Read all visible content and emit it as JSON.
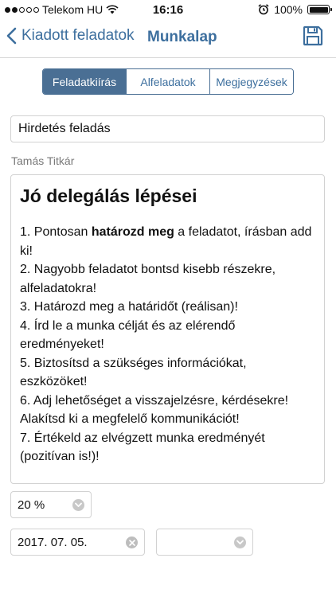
{
  "status_bar": {
    "carrier": "Telekom HU",
    "time": "16:16",
    "battery": "100%",
    "signal_dots_filled": 2,
    "signal_dots_total": 5
  },
  "nav": {
    "back_label": "Kiadott feladatok",
    "title": "Munkalap"
  },
  "tabs": [
    {
      "label": "Feladatkiírás",
      "active": true
    },
    {
      "label": "Alfeladatok",
      "active": false
    },
    {
      "label": "Megjegyzések",
      "active": false
    }
  ],
  "task": {
    "title_value": "Hirdetés feladás",
    "assignee": "Tamás Titkár",
    "description": {
      "heading": "Jó delegálás lépései",
      "steps": [
        {
          "prefix": "1. Pontosan ",
          "bold": "határozd meg",
          "suffix": " a feladatot, írásban add ki!"
        },
        {
          "text": "2. Nagyobb feladatot bontsd kisebb részekre, alfeladatokra!"
        },
        {
          "text": "3. Határozd meg a határidőt (reálisan)!"
        },
        {
          "text": "4. Írd le a munka célját és az elérendő eredményeket!"
        },
        {
          "text": "5. Biztosítsd a szükséges információkat, eszközöket!"
        },
        {
          "text": "6. Adj lehetőséget a visszajelzésre, kérdésekre! Alakítsd ki a megfelelő kommunikációt!"
        },
        {
          "text": "7. Értékeld az elvégzett munka eredményét (pozitívan is!)!"
        }
      ]
    },
    "progress": "20 %",
    "deadline": "2017. 07. 05.",
    "time_value": ""
  },
  "colors": {
    "accent": "#3d6f9e",
    "segment_active_bg": "#4a6f94",
    "border": "#d2d2d2",
    "muted_text": "#7a7a7a"
  }
}
